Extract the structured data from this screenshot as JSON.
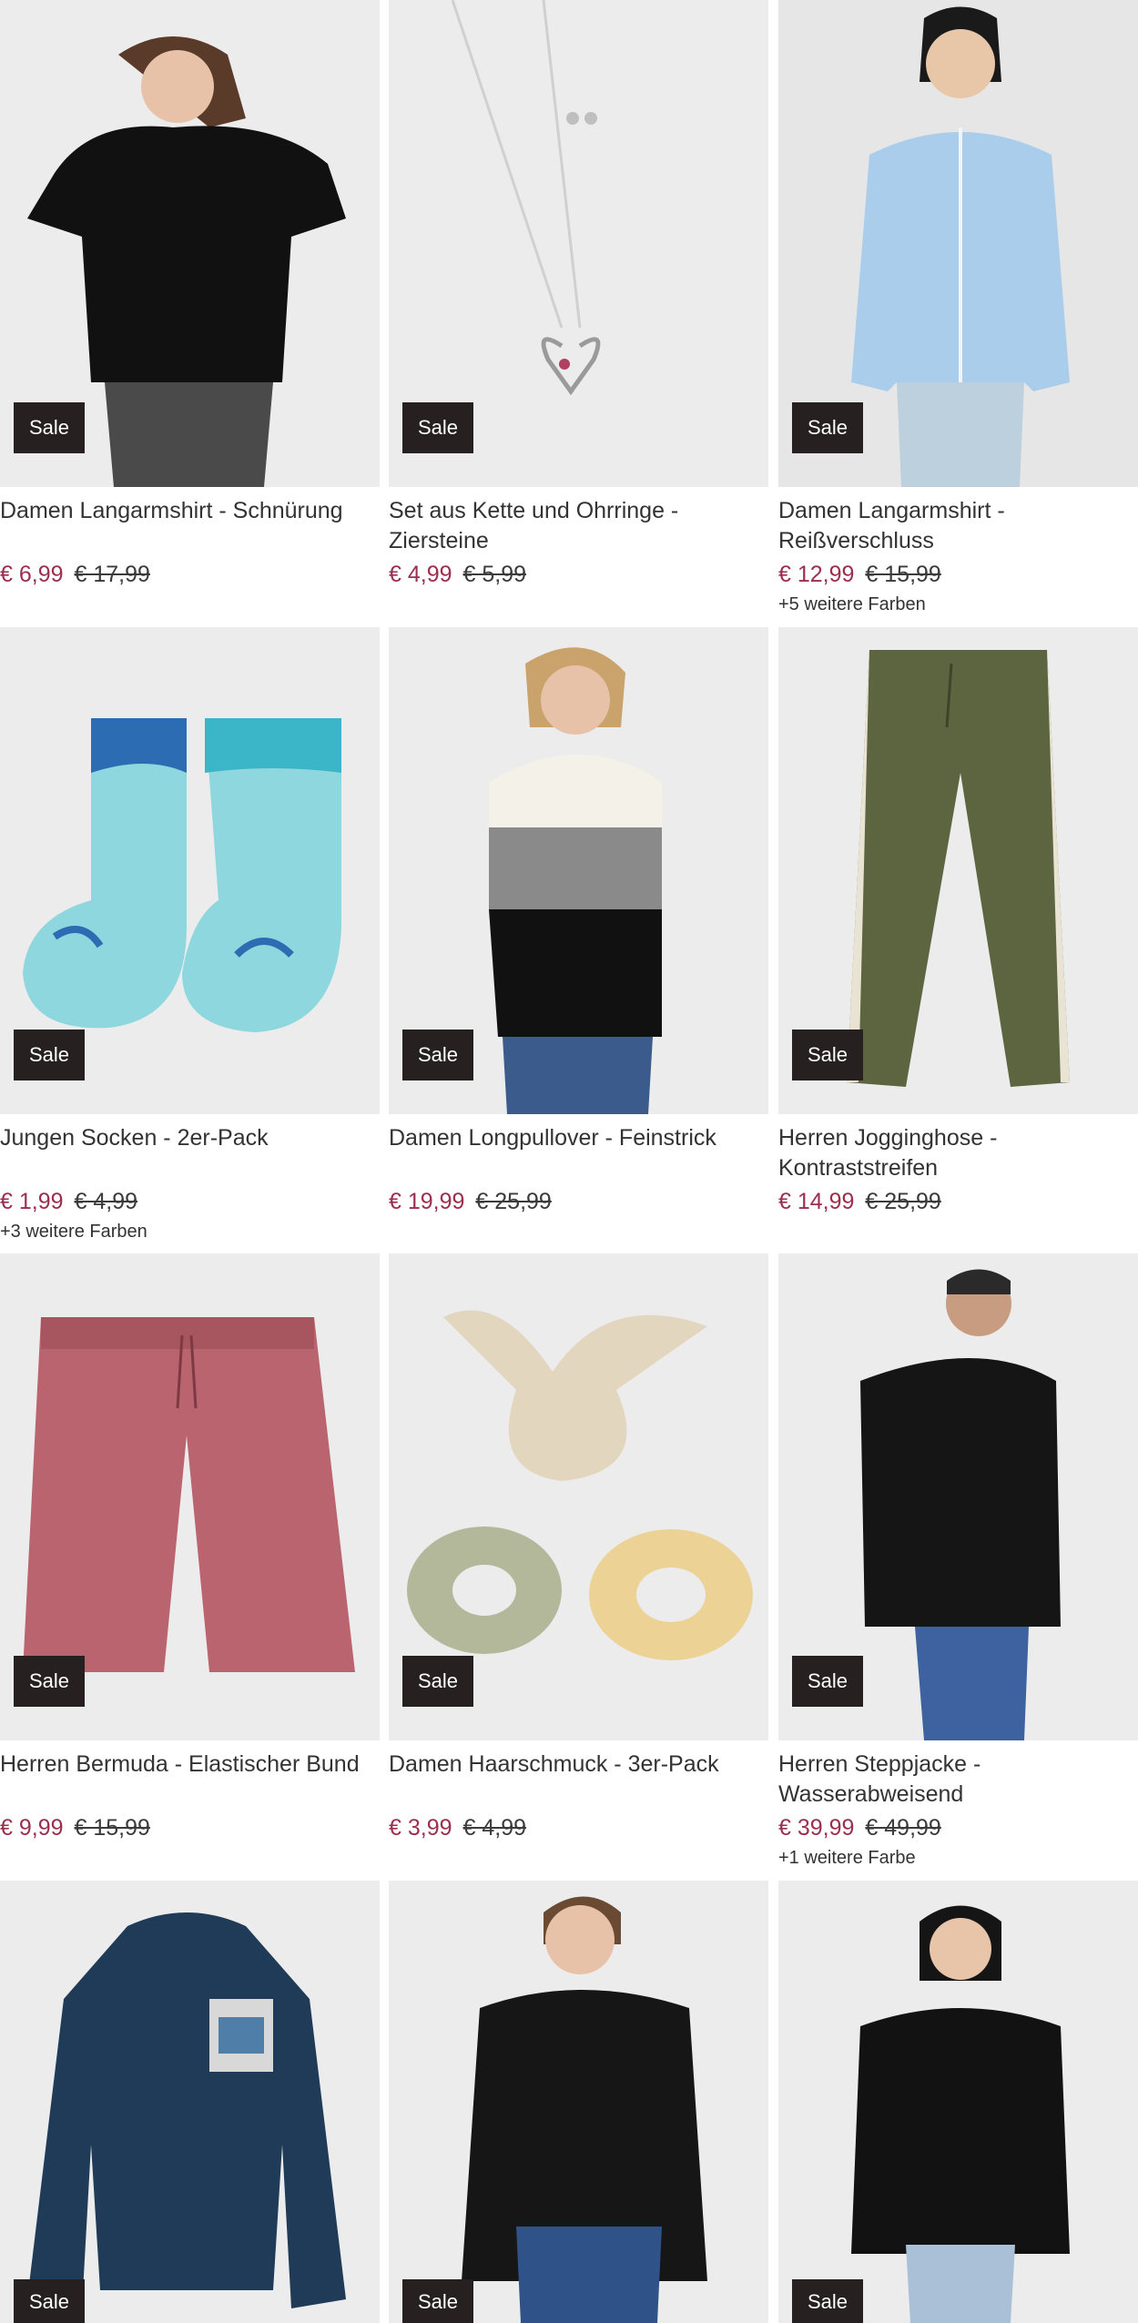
{
  "products": [
    {
      "title": "Damen Langarmshirt - Schnürung",
      "price": "€ 6,99",
      "old_price": "€ 17,99",
      "badge": "Sale",
      "colors": ""
    },
    {
      "title": "Set aus Kette und Ohrringe - Ziersteine",
      "price": "€ 4,99",
      "old_price": "€ 5,99",
      "badge": "Sale",
      "colors": ""
    },
    {
      "title": "Damen Langarmshirt - Reißverschluss",
      "price": "€ 12,99",
      "old_price": "€ 15,99",
      "badge": "Sale",
      "colors": "+5 weitere Farben"
    },
    {
      "title": "Jungen Socken - 2er-Pack",
      "price": "€ 1,99",
      "old_price": "€ 4,99",
      "badge": "Sale",
      "colors": "+3 weitere Farben"
    },
    {
      "title": "Damen Longpullover - Feinstrick",
      "price": "€ 19,99",
      "old_price": "€ 25,99",
      "badge": "Sale",
      "colors": ""
    },
    {
      "title": "Herren Jogginghose - Kontraststreifen",
      "price": "€ 14,99",
      "old_price": "€ 25,99",
      "badge": "Sale",
      "colors": ""
    },
    {
      "title": "Herren Bermuda - Elastischer Bund",
      "price": "€ 9,99",
      "old_price": "€ 15,99",
      "badge": "Sale",
      "colors": ""
    },
    {
      "title": "Damen Haarschmuck - 3er-Pack",
      "price": "€ 3,99",
      "old_price": "€ 4,99",
      "badge": "Sale",
      "colors": ""
    },
    {
      "title": "Herren Steppjacke - Wasserabweisend",
      "price": "€ 39,99",
      "old_price": "€ 49,99",
      "badge": "Sale",
      "colors": "+1 weitere Farbe"
    },
    {
      "title": "",
      "price": "",
      "old_price": "",
      "badge": "Sale",
      "colors": ""
    },
    {
      "title": "",
      "price": "",
      "old_price": "",
      "badge": "Sale",
      "colors": ""
    },
    {
      "title": "",
      "price": "",
      "old_price": "",
      "badge": "Sale",
      "colors": ""
    }
  ]
}
